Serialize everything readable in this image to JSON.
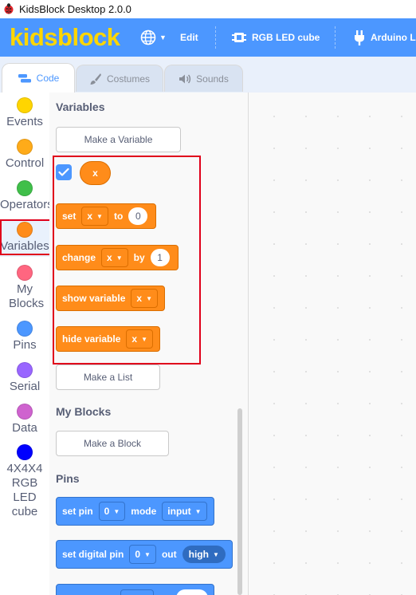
{
  "window": {
    "title": "KidsBlock Desktop 2.0.0"
  },
  "menubar": {
    "logo": "kidsblock",
    "language_icon": "globe-icon",
    "edit": "Edit",
    "device": "RGB LED cube",
    "board": "Arduino L"
  },
  "tabs": [
    {
      "label": "Code",
      "icon": "code-icon",
      "active": true
    },
    {
      "label": "Costumes",
      "icon": "brush-icon",
      "active": false
    },
    {
      "label": "Sounds",
      "icon": "speaker-icon",
      "active": false
    }
  ],
  "categories": [
    {
      "label": "Events",
      "color": "#ffd500"
    },
    {
      "label": "Control",
      "color": "#ffab19"
    },
    {
      "label": "Operators",
      "color": "#40bf4a"
    },
    {
      "label": "Variables",
      "color": "#ff8c1a",
      "selected": true
    },
    {
      "label": "My Blocks",
      "color": "#ff6680"
    },
    {
      "label": "Pins",
      "color": "#4c97ff"
    },
    {
      "label": "Serial",
      "color": "#9966ff"
    },
    {
      "label": "Data",
      "color": "#cf63cf"
    },
    {
      "label": "4X4X4 RGB LED cube",
      "color": "#0000ff"
    }
  ],
  "palette": {
    "variables_header": "Variables",
    "make_variable": "Make a Variable",
    "variable_reporter": "x",
    "variable_checked": true,
    "set_block": {
      "word": "set",
      "var": "x",
      "to": "to",
      "value": "0"
    },
    "change_block": {
      "word": "change",
      "var": "x",
      "by": "by",
      "value": "1"
    },
    "show_block": {
      "word": "show variable",
      "var": "x"
    },
    "hide_block": {
      "word": "hide variable",
      "var": "x"
    },
    "make_list": "Make a List",
    "myblocks_header": "My Blocks",
    "make_block": "Make a Block",
    "pins_header": "Pins",
    "set_pin_block": {
      "word": "set pin",
      "pin": "0",
      "mode_word": "mode",
      "mode": "input"
    },
    "set_digital_block": {
      "word": "set digital pin",
      "pin": "0",
      "out_word": "out",
      "level": "high"
    }
  },
  "colors": {
    "accent": "#4c97ff",
    "logo": "#ffd600",
    "variables": "#ff8c1a",
    "highlight": "#e0001b"
  }
}
